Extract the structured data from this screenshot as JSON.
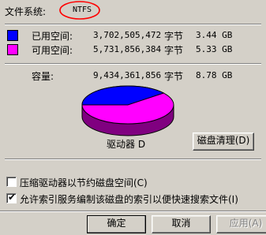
{
  "filesystem": {
    "label": "文件系统:",
    "value": "NTFS"
  },
  "used": {
    "label": "已用空间:",
    "bytes": "3,702,505,472",
    "unit": "字节",
    "size": "3.44 GB",
    "color": "#0000ff"
  },
  "free": {
    "label": "可用空间:",
    "bytes": "5,731,856,384",
    "unit": "字节",
    "size": "5.33 GB",
    "color": "#ff00ff"
  },
  "capacity": {
    "label": "容量:",
    "bytes": "9,434,361,856",
    "unit": "字节",
    "size": "8.78 GB"
  },
  "pie": {
    "used_fraction": 0.3925
  },
  "drive_label": "驱动器 D",
  "cleanup_button": "磁盘清理(D)",
  "options": [
    {
      "label": "压缩驱动器以节约磁盘空间(C)",
      "checked": false
    },
    {
      "label": "允许索引服务编制该磁盘的索引以便快速搜索文件(I)",
      "checked": true
    }
  ],
  "buttons": {
    "ok": "确定",
    "cancel": "取消",
    "apply": "应用(A)"
  },
  "highlight_color": "#ff0000"
}
